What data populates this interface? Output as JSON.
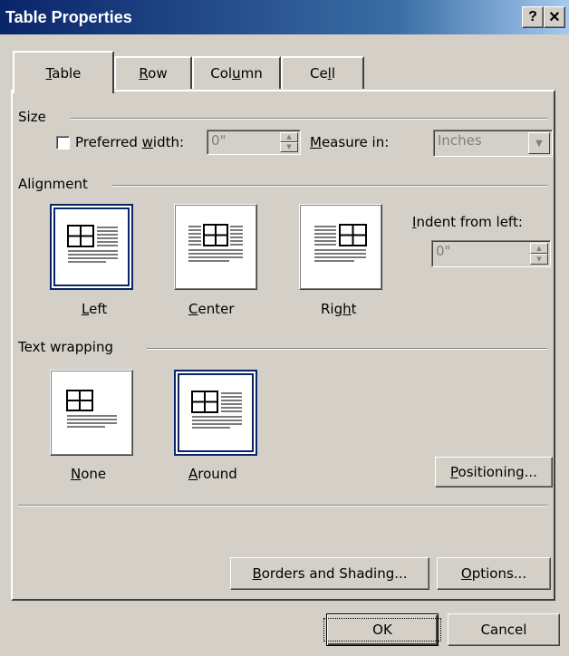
{
  "window": {
    "title": "Table Properties",
    "help_glyph": "?",
    "close_glyph": "✕"
  },
  "tabs": [
    {
      "label": "Table",
      "mnemonic": "T",
      "rest": "able",
      "active": true
    },
    {
      "label": "Row",
      "mnemonic": "R",
      "rest": "ow"
    },
    {
      "pre": "Col",
      "mnemonic": "u",
      "rest": "mn",
      "label": "Column"
    },
    {
      "pre": "Ce",
      "mnemonic": "l",
      "rest": "l",
      "label": "Cell"
    }
  ],
  "size": {
    "group_label": "Size",
    "preferred_width": {
      "pre": "Preferred ",
      "mnemonic": "w",
      "rest": "idth:",
      "value": "0\"",
      "checked": false
    },
    "measure_in": {
      "mnemonic": "M",
      "rest": "easure in:",
      "value": "Inches"
    }
  },
  "alignment": {
    "group_label": "Alignment",
    "selected": "Left",
    "options": [
      {
        "label": "Left",
        "mnemonic": "L",
        "rest": "eft"
      },
      {
        "label": "Center",
        "mnemonic": "C",
        "rest": "enter"
      },
      {
        "label": "Right",
        "pre": "Rig",
        "mnemonic": "h",
        "rest": "t"
      }
    ],
    "indent": {
      "mnemonic": "I",
      "rest": "ndent from left:",
      "value": "0\""
    }
  },
  "text_wrapping": {
    "group_label": "Text wrapping",
    "selected": "Around",
    "options": [
      {
        "label": "None",
        "mnemonic": "N",
        "rest": "one"
      },
      {
        "label": "Around",
        "mnemonic": "A",
        "rest": "round"
      }
    ],
    "positioning_button": {
      "mnemonic": "P",
      "rest": "ositioning..."
    }
  },
  "buttons": {
    "borders": {
      "mnemonic": "B",
      "rest": "orders and Shading..."
    },
    "options": {
      "mnemonic": "O",
      "rest": "ptions..."
    },
    "ok": "OK",
    "cancel": "Cancel"
  },
  "colors": {
    "face": "#d4d0c8",
    "title_start": "#0a246a",
    "title_end": "#a6caf0",
    "selection": "#0a246a",
    "disabled_text": "#808080"
  }
}
